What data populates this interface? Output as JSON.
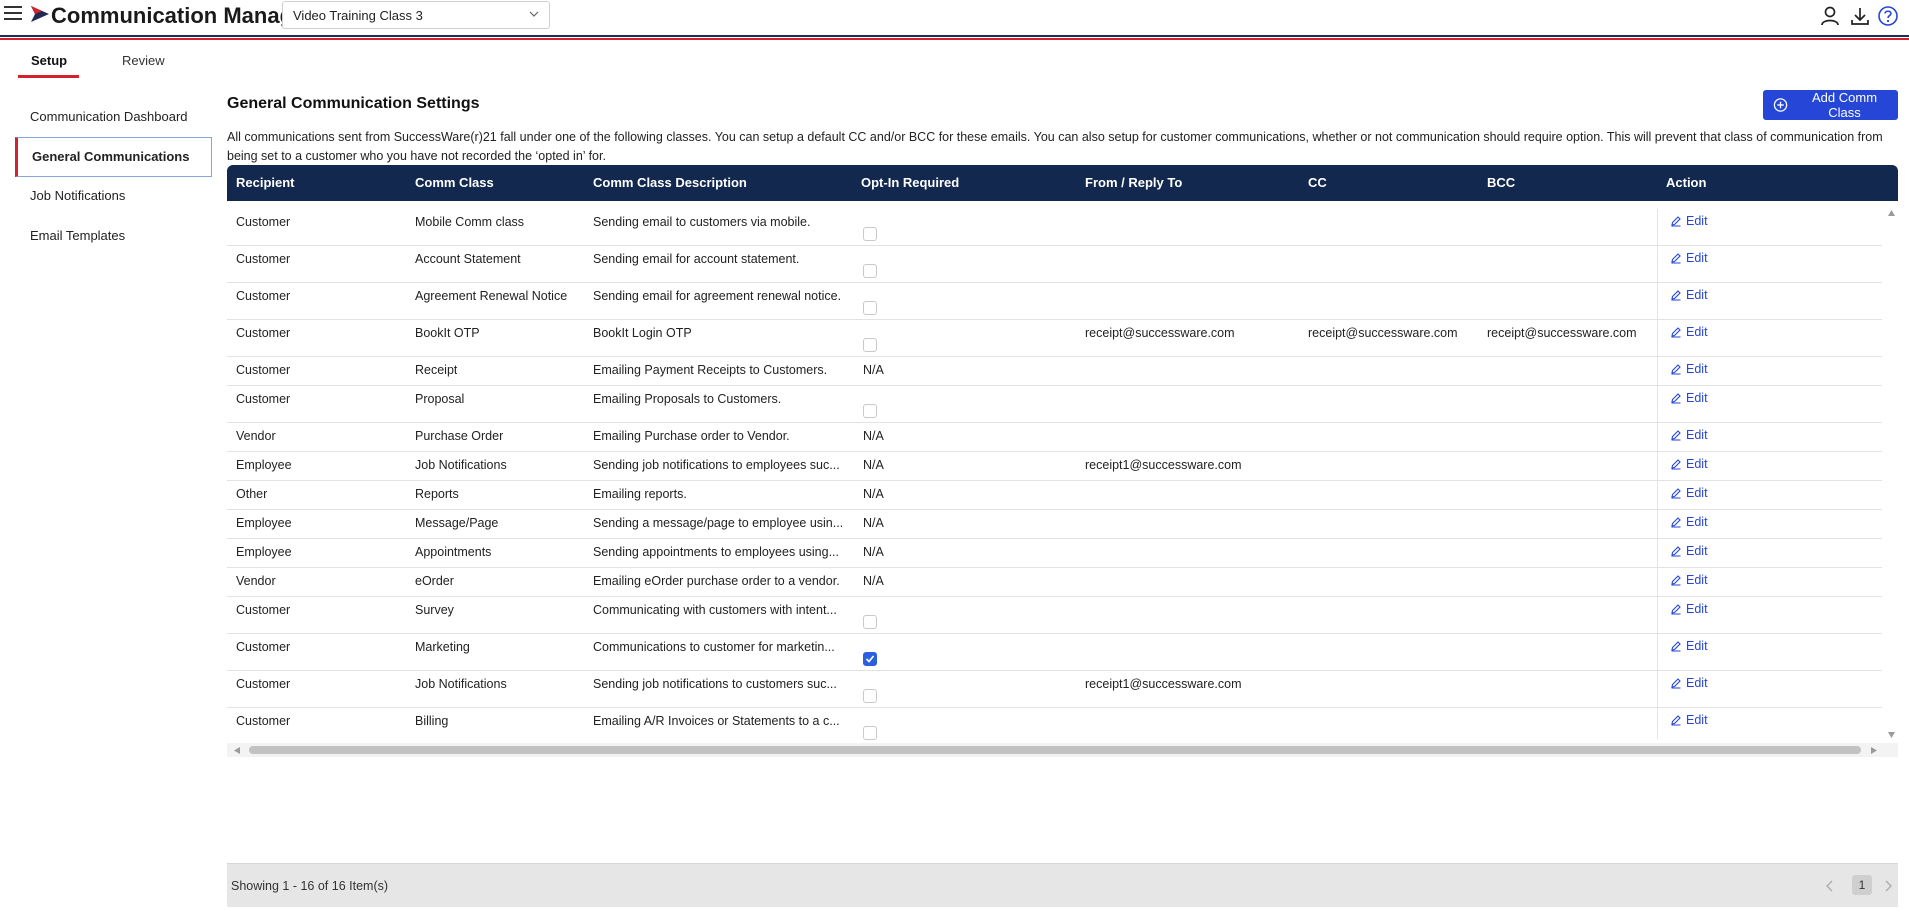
{
  "header": {
    "app_title": "Communication Manager",
    "class_selector_value": "Video Training Class 3",
    "icons": [
      "menu-icon",
      "user-icon",
      "download-icon",
      "help-icon"
    ],
    "brand_colors": {
      "navy": "#1f2a55",
      "red": "#d3212d",
      "accent_blue": "#2546d6"
    }
  },
  "tabs": [
    {
      "label": "Setup",
      "active": true
    },
    {
      "label": "Review",
      "active": false
    }
  ],
  "sidebar": {
    "items": [
      {
        "label": "Communication Dashboard",
        "active": false
      },
      {
        "label": "General Communications",
        "active": true
      },
      {
        "label": "Job Notifications",
        "active": false
      },
      {
        "label": "Email Templates",
        "active": false
      }
    ]
  },
  "main": {
    "title": "General Communication Settings",
    "add_button_label": "Add Comm Class",
    "intro_text": "All communications sent from SuccessWare(r)21 fall under one of the following classes. You can setup a default CC and/or BCC for these emails. You can also setup for customer communications, whether or not communication should require option. This will prevent that class of communication from being set to a customer who you have not recorded the ‘opted in’ for."
  },
  "table": {
    "columns": [
      "Recipient",
      "Comm Class",
      "Comm Class Description",
      "Opt-In Required",
      "From / Reply To",
      "CC",
      "BCC",
      "Action"
    ],
    "edit_label": "Edit",
    "rows": [
      {
        "recipient": "Customer",
        "comm_class": "Mobile Comm class",
        "description": "Sending email to customers via mobile.",
        "opt_in": "checkbox",
        "checked": false,
        "from": "",
        "cc": "",
        "bcc": ""
      },
      {
        "recipient": "Customer",
        "comm_class": "Account Statement",
        "description": "Sending email for account statement.",
        "opt_in": "checkbox",
        "checked": false,
        "from": "",
        "cc": "",
        "bcc": ""
      },
      {
        "recipient": "Customer",
        "comm_class": "Agreement Renewal Notice",
        "description": "Sending email for agreement renewal notice.",
        "opt_in": "checkbox",
        "checked": false,
        "from": "",
        "cc": "",
        "bcc": ""
      },
      {
        "recipient": "Customer",
        "comm_class": "BookIt OTP",
        "description": "BookIt Login OTP",
        "opt_in": "checkbox",
        "checked": false,
        "from": "receipt@successware.com",
        "cc": "receipt@successware.com",
        "bcc": "receipt@successware.com"
      },
      {
        "recipient": "Customer",
        "comm_class": "Receipt",
        "description": "Emailing Payment Receipts to Customers.",
        "opt_in": "N/A",
        "checked": false,
        "from": "",
        "cc": "",
        "bcc": ""
      },
      {
        "recipient": "Customer",
        "comm_class": "Proposal",
        "description": "Emailing Proposals to Customers.",
        "opt_in": "checkbox",
        "checked": false,
        "from": "",
        "cc": "",
        "bcc": ""
      },
      {
        "recipient": "Vendor",
        "comm_class": "Purchase Order",
        "description": "Emailing Purchase order to Vendor.",
        "opt_in": "N/A",
        "checked": false,
        "from": "",
        "cc": "",
        "bcc": ""
      },
      {
        "recipient": "Employee",
        "comm_class": "Job Notifications",
        "description": "Sending job notifications to employees suc...",
        "opt_in": "N/A",
        "checked": false,
        "from": "receipt1@successware.com",
        "cc": "",
        "bcc": ""
      },
      {
        "recipient": "Other",
        "comm_class": "Reports",
        "description": "Emailing reports.",
        "opt_in": "N/A",
        "checked": false,
        "from": "",
        "cc": "",
        "bcc": ""
      },
      {
        "recipient": "Employee",
        "comm_class": "Message/Page",
        "description": "Sending a message/page to employee usin...",
        "opt_in": "N/A",
        "checked": false,
        "from": "",
        "cc": "",
        "bcc": ""
      },
      {
        "recipient": "Employee",
        "comm_class": "Appointments",
        "description": "Sending appointments to employees using...",
        "opt_in": "N/A",
        "checked": false,
        "from": "",
        "cc": "",
        "bcc": ""
      },
      {
        "recipient": "Vendor",
        "comm_class": "eOrder",
        "description": "Emailing eOrder purchase order to a vendor.",
        "opt_in": "N/A",
        "checked": false,
        "from": "",
        "cc": "",
        "bcc": ""
      },
      {
        "recipient": "Customer",
        "comm_class": "Survey",
        "description": "Communicating with customers with intent...",
        "opt_in": "checkbox",
        "checked": false,
        "from": "",
        "cc": "",
        "bcc": ""
      },
      {
        "recipient": "Customer",
        "comm_class": "Marketing",
        "description": "Communications to customer for marketin...",
        "opt_in": "checkbox",
        "checked": true,
        "from": "",
        "cc": "",
        "bcc": ""
      },
      {
        "recipient": "Customer",
        "comm_class": "Job Notifications",
        "description": "Sending job notifications to customers suc...",
        "opt_in": "checkbox",
        "checked": false,
        "from": "receipt1@successware.com",
        "cc": "",
        "bcc": ""
      },
      {
        "recipient": "Customer",
        "comm_class": "Billing",
        "description": "Emailing A/R Invoices or Statements to a c...",
        "opt_in": "checkbox",
        "checked": false,
        "from": "",
        "cc": "",
        "bcc": ""
      }
    ]
  },
  "footer": {
    "summary": "Showing 1 - 16 of 16 Item(s)",
    "current_page": "1"
  }
}
